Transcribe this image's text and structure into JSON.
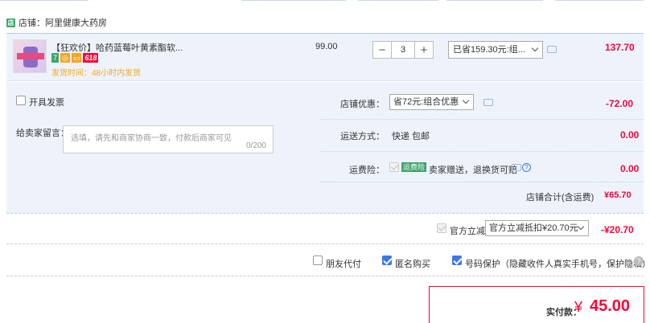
{
  "store": {
    "badge": "店",
    "label": "店铺：",
    "name": "阿里健康大药房"
  },
  "item": {
    "title": "【狂欢价】哈药蓝莓叶黄素酯软...",
    "tags": [
      {
        "text": "7",
        "color": "#3aa76d"
      },
      {
        "text": "◎",
        "color": "#f5a623"
      },
      {
        "text": "▭",
        "color": "#f5a623"
      },
      {
        "text": "618",
        "color": "#ff0036"
      }
    ],
    "ship_time": "发货时间：48小时内发货",
    "price": "99.00",
    "qty_minus": "−",
    "quantity": "3",
    "qty_plus": "+",
    "promo_selected": "已省159.30元:组...",
    "total": "137.70"
  },
  "invoice": {
    "label": "开具发票"
  },
  "message": {
    "label": "给卖家留言：",
    "placeholder": "选填，请先和商家协商一致，付款后商家可见",
    "counter": "0/200"
  },
  "store_discount": {
    "label": "店铺优惠：",
    "selected": "省72元:组合优惠",
    "amount": "-72.00"
  },
  "delivery": {
    "label": "运送方式：",
    "value": "快递 包邮",
    "amount": "0.00"
  },
  "insurance": {
    "label": "运费险：",
    "tag": "运费险",
    "text": "卖家赠送，退换货可赔",
    "help": "?",
    "amount": "0.00"
  },
  "store_total": {
    "label": "店铺合计(含运费)",
    "amount": "¥65.70"
  },
  "official": {
    "label": "官方立减",
    "selected": "官方立减抵扣¥20.70元",
    "amount": "-¥20.70"
  },
  "options": {
    "friend_pay": "朋友代付",
    "anonymous": "匿名购买",
    "privacy": "号码保护（隐藏收件人真实手机号，保护隐私）",
    "help": "?"
  },
  "payment": {
    "label": "实付款：",
    "currency": "¥",
    "amount": "45.00"
  }
}
